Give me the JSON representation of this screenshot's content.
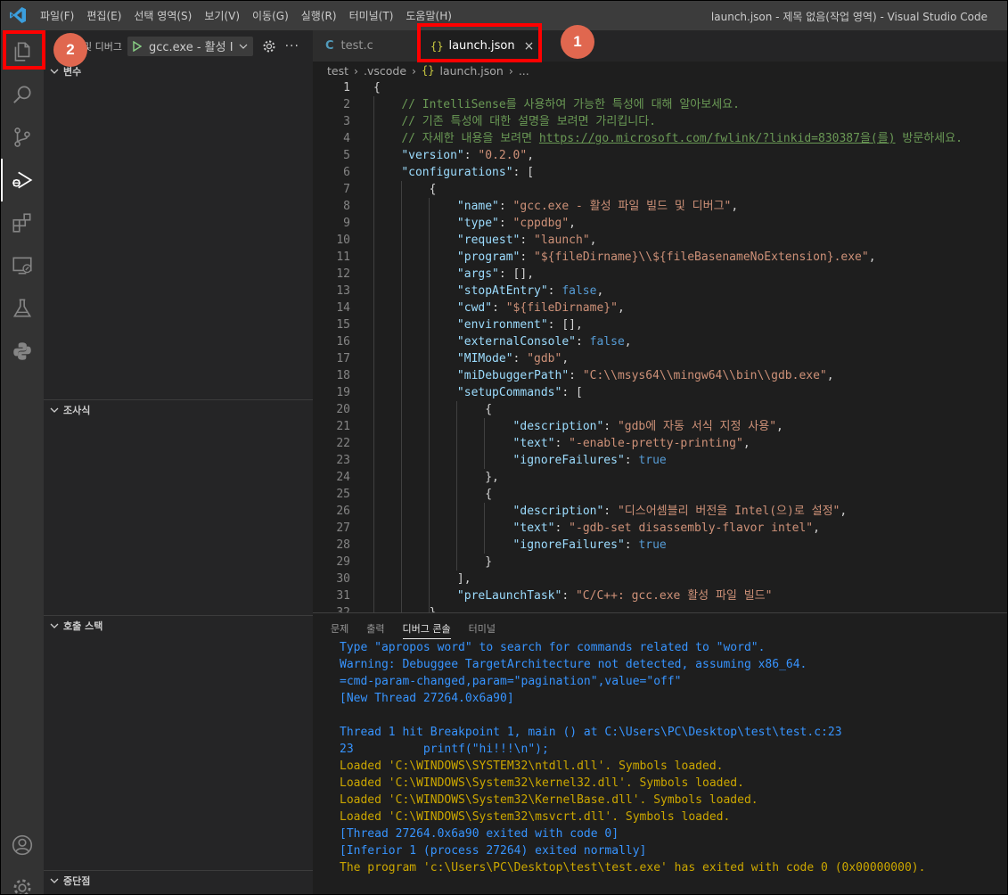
{
  "titlebar": {
    "menu": [
      "파일(F)",
      "편집(E)",
      "선택 영역(S)",
      "보기(V)",
      "이동(G)",
      "실행(R)",
      "터미널(T)",
      "도움말(H)"
    ],
    "window_title": "launch.json - 제목 없음(작업 영역) - Visual Studio Code"
  },
  "activity_bar": {
    "icons": [
      "explorer-icon",
      "search-icon",
      "source-control-icon",
      "run-debug-icon",
      "extensions-icon",
      "remote-explorer-icon",
      "testing-icon",
      "python-icon",
      "account-icon",
      "manage-gear-icon"
    ]
  },
  "sidebar": {
    "header_title": "및 디버그",
    "run_config": "gcc.exe - 활성 I",
    "sections": {
      "variables": "변수",
      "watch": "조사식",
      "call_stack": "호출 스택",
      "breakpoints": "중단점"
    }
  },
  "tabs": [
    {
      "label": "test.c",
      "icon": "C"
    },
    {
      "label": "launch.json",
      "icon": "{}",
      "close": "×"
    }
  ],
  "breadcrumb": {
    "items": [
      "test",
      ".vscode",
      "launch.json",
      "..."
    ],
    "json_icon": "{}"
  },
  "editor": {
    "lines": [
      {
        "n": "1",
        "parts": [
          [
            "p",
            "{"
          ]
        ]
      },
      {
        "n": "2",
        "parts": [
          [
            "p",
            "    "
          ],
          [
            "cm",
            "// IntelliSense를 사용하여 가능한 특성에 대해 알아보세요."
          ]
        ]
      },
      {
        "n": "3",
        "parts": [
          [
            "p",
            "    "
          ],
          [
            "cm",
            "// 기존 특성에 대한 설명을 보려면 가리킵니다."
          ]
        ]
      },
      {
        "n": "4",
        "parts": [
          [
            "p",
            "    "
          ],
          [
            "cm",
            "// 자세한 내용을 보려면 "
          ],
          [
            "lk",
            "https://go.microsoft.com/fwlink/?linkid=830387을(를)"
          ],
          [
            "cm",
            " 방문하세요."
          ]
        ]
      },
      {
        "n": "5",
        "parts": [
          [
            "p",
            "    "
          ],
          [
            "k",
            "\"version\""
          ],
          [
            "p",
            ": "
          ],
          [
            "s",
            "\"0.2.0\""
          ],
          [
            "p",
            ","
          ]
        ]
      },
      {
        "n": "6",
        "parts": [
          [
            "p",
            "    "
          ],
          [
            "k",
            "\"configurations\""
          ],
          [
            "p",
            ": ["
          ]
        ]
      },
      {
        "n": "7",
        "parts": [
          [
            "p",
            "        {"
          ]
        ]
      },
      {
        "n": "8",
        "parts": [
          [
            "p",
            "            "
          ],
          [
            "k",
            "\"name\""
          ],
          [
            "p",
            ": "
          ],
          [
            "s",
            "\"gcc.exe - 활성 파일 빌드 및 디버그\""
          ],
          [
            "p",
            ","
          ]
        ]
      },
      {
        "n": "9",
        "parts": [
          [
            "p",
            "            "
          ],
          [
            "k",
            "\"type\""
          ],
          [
            "p",
            ": "
          ],
          [
            "s",
            "\"cppdbg\""
          ],
          [
            "p",
            ","
          ]
        ]
      },
      {
        "n": "10",
        "parts": [
          [
            "p",
            "            "
          ],
          [
            "k",
            "\"request\""
          ],
          [
            "p",
            ": "
          ],
          [
            "s",
            "\"launch\""
          ],
          [
            "p",
            ","
          ]
        ]
      },
      {
        "n": "11",
        "parts": [
          [
            "p",
            "            "
          ],
          [
            "k",
            "\"program\""
          ],
          [
            "p",
            ": "
          ],
          [
            "s",
            "\"${fileDirname}\\\\${fileBasenameNoExtension}.exe\""
          ],
          [
            "p",
            ","
          ]
        ]
      },
      {
        "n": "12",
        "parts": [
          [
            "p",
            "            "
          ],
          [
            "k",
            "\"args\""
          ],
          [
            "p",
            ": [],"
          ]
        ]
      },
      {
        "n": "13",
        "parts": [
          [
            "p",
            "            "
          ],
          [
            "k",
            "\"stopAtEntry\""
          ],
          [
            "p",
            ": "
          ],
          [
            "b",
            "false"
          ],
          [
            "p",
            ","
          ]
        ]
      },
      {
        "n": "14",
        "parts": [
          [
            "p",
            "            "
          ],
          [
            "k",
            "\"cwd\""
          ],
          [
            "p",
            ": "
          ],
          [
            "s",
            "\"${fileDirname}\""
          ],
          [
            "p",
            ","
          ]
        ]
      },
      {
        "n": "15",
        "parts": [
          [
            "p",
            "            "
          ],
          [
            "k",
            "\"environment\""
          ],
          [
            "p",
            ": [],"
          ]
        ]
      },
      {
        "n": "16",
        "parts": [
          [
            "p",
            "            "
          ],
          [
            "k",
            "\"externalConsole\""
          ],
          [
            "p",
            ": "
          ],
          [
            "b",
            "false"
          ],
          [
            "p",
            ","
          ]
        ]
      },
      {
        "n": "17",
        "parts": [
          [
            "p",
            "            "
          ],
          [
            "k",
            "\"MIMode\""
          ],
          [
            "p",
            ": "
          ],
          [
            "s",
            "\"gdb\""
          ],
          [
            "p",
            ","
          ]
        ]
      },
      {
        "n": "18",
        "parts": [
          [
            "p",
            "            "
          ],
          [
            "k",
            "\"miDebuggerPath\""
          ],
          [
            "p",
            ": "
          ],
          [
            "s",
            "\"C:\\\\msys64\\\\mingw64\\\\bin\\\\gdb.exe\""
          ],
          [
            "p",
            ","
          ]
        ]
      },
      {
        "n": "19",
        "parts": [
          [
            "p",
            "            "
          ],
          [
            "k",
            "\"setupCommands\""
          ],
          [
            "p",
            ": ["
          ]
        ]
      },
      {
        "n": "20",
        "parts": [
          [
            "p",
            "                {"
          ]
        ]
      },
      {
        "n": "21",
        "parts": [
          [
            "p",
            "                    "
          ],
          [
            "k",
            "\"description\""
          ],
          [
            "p",
            ": "
          ],
          [
            "s",
            "\"gdb에 자동 서식 지정 사용\""
          ],
          [
            "p",
            ","
          ]
        ]
      },
      {
        "n": "22",
        "parts": [
          [
            "p",
            "                    "
          ],
          [
            "k",
            "\"text\""
          ],
          [
            "p",
            ": "
          ],
          [
            "s",
            "\"-enable-pretty-printing\""
          ],
          [
            "p",
            ","
          ]
        ]
      },
      {
        "n": "23",
        "parts": [
          [
            "p",
            "                    "
          ],
          [
            "k",
            "\"ignoreFailures\""
          ],
          [
            "p",
            ": "
          ],
          [
            "b",
            "true"
          ]
        ]
      },
      {
        "n": "24",
        "parts": [
          [
            "p",
            "                },"
          ]
        ]
      },
      {
        "n": "25",
        "parts": [
          [
            "p",
            "                {"
          ]
        ]
      },
      {
        "n": "26",
        "parts": [
          [
            "p",
            "                    "
          ],
          [
            "k",
            "\"description\""
          ],
          [
            "p",
            ": "
          ],
          [
            "s",
            "\"디스어셈블리 버전을 Intel(으)로 설정\""
          ],
          [
            "p",
            ","
          ]
        ]
      },
      {
        "n": "27",
        "parts": [
          [
            "p",
            "                    "
          ],
          [
            "k",
            "\"text\""
          ],
          [
            "p",
            ": "
          ],
          [
            "s",
            "\"-gdb-set disassembly-flavor intel\""
          ],
          [
            "p",
            ","
          ]
        ]
      },
      {
        "n": "28",
        "parts": [
          [
            "p",
            "                    "
          ],
          [
            "k",
            "\"ignoreFailures\""
          ],
          [
            "p",
            ": "
          ],
          [
            "b",
            "true"
          ]
        ]
      },
      {
        "n": "29",
        "parts": [
          [
            "p",
            "                }"
          ]
        ]
      },
      {
        "n": "30",
        "parts": [
          [
            "p",
            "            ],"
          ]
        ]
      },
      {
        "n": "31",
        "parts": [
          [
            "p",
            "            "
          ],
          [
            "k",
            "\"preLaunchTask\""
          ],
          [
            "p",
            ": "
          ],
          [
            "s",
            "\"C/C++: gcc.exe 활성 파일 빌드\""
          ]
        ]
      },
      {
        "n": "32",
        "parts": [
          [
            "p",
            "        }"
          ]
        ]
      }
    ]
  },
  "panel": {
    "tabs": [
      "문제",
      "출력",
      "디버그 콘솔",
      "터미널"
    ],
    "active_tab": "디버그 콘솔",
    "output": [
      {
        "c": "blue",
        "t": "Type \"apropos word\" to search for commands related to \"word\"."
      },
      {
        "c": "blue",
        "t": "Warning: Debuggee TargetArchitecture not detected, assuming x86_64."
      },
      {
        "c": "blue",
        "t": "=cmd-param-changed,param=\"pagination\",value=\"off\""
      },
      {
        "c": "blue",
        "t": "[New Thread 27264.0x6a90]"
      },
      {
        "c": "blue",
        "t": ""
      },
      {
        "c": "blue",
        "t": "Thread 1 hit Breakpoint 1, main () at C:\\Users\\PC\\Desktop\\test\\test.c:23"
      },
      {
        "c": "blue",
        "t": "23          printf(\"hi!!!\\n\");"
      },
      {
        "c": "orange",
        "t": "Loaded 'C:\\WINDOWS\\SYSTEM32\\ntdll.dll'. Symbols loaded."
      },
      {
        "c": "orange",
        "t": "Loaded 'C:\\WINDOWS\\System32\\kernel32.dll'. Symbols loaded."
      },
      {
        "c": "orange",
        "t": "Loaded 'C:\\WINDOWS\\System32\\KernelBase.dll'. Symbols loaded."
      },
      {
        "c": "orange",
        "t": "Loaded 'C:\\WINDOWS\\System32\\msvcrt.dll'. Symbols loaded."
      },
      {
        "c": "blue",
        "t": "[Thread 27264.0x6a90 exited with code 0]"
      },
      {
        "c": "blue",
        "t": "[Inferior 1 (process 27264) exited normally]"
      },
      {
        "c": "orange",
        "t": "The program 'c:\\Users\\PC\\Desktop\\test\\test.exe' has exited with code 0 (0x00000000)."
      }
    ]
  },
  "annotations": {
    "badge_1": "1",
    "badge_2": "2"
  },
  "colors": {
    "annotation_red": "#ff0000",
    "badge": "#e0674f",
    "console_blue": "#3794ff",
    "console_orange": "#cca700"
  }
}
